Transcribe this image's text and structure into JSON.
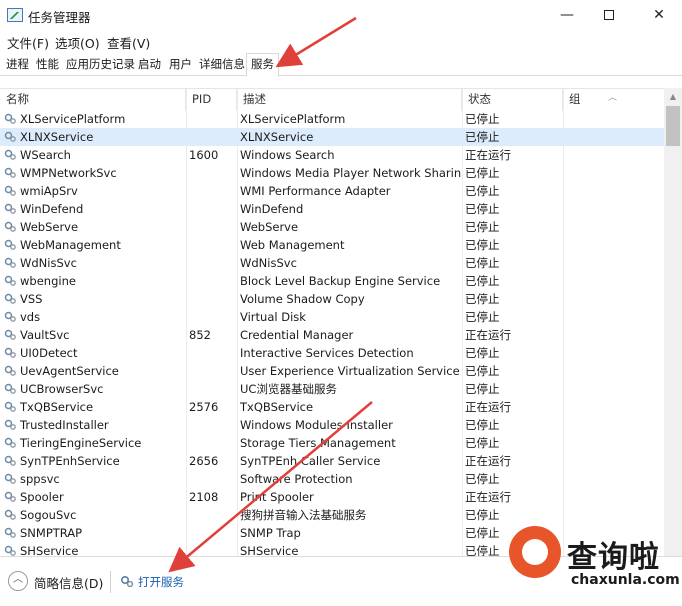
{
  "window": {
    "title": "任务管理器",
    "minimize_glyph": "—",
    "close_glyph": "✕"
  },
  "menu": [
    "文件(F)",
    "选项(O)",
    "查看(V)"
  ],
  "tabs": [
    "进程",
    "性能",
    "应用历史记录",
    "启动",
    "用户",
    "详细信息",
    "服务"
  ],
  "active_tab": "服务",
  "columns": {
    "name": "名称",
    "pid": "PID",
    "desc": "描述",
    "status": "状态",
    "group": "组"
  },
  "rows": [
    {
      "name": "XLServicePlatform",
      "pid": "",
      "desc": "XLServicePlatform",
      "status": "已停止",
      "group": ""
    },
    {
      "name": "XLNXService",
      "pid": "",
      "desc": "XLNXService",
      "status": "已停止",
      "group": "",
      "selected": true
    },
    {
      "name": "WSearch",
      "pid": "1600",
      "desc": "Windows Search",
      "status": "正在运行",
      "group": ""
    },
    {
      "name": "WMPNetworkSvc",
      "pid": "",
      "desc": "Windows Media Player Network Sharing ...",
      "status": "已停止",
      "group": ""
    },
    {
      "name": "wmiApSrv",
      "pid": "",
      "desc": "WMI Performance Adapter",
      "status": "已停止",
      "group": ""
    },
    {
      "name": "WinDefend",
      "pid": "",
      "desc": "WinDefend",
      "status": "已停止",
      "group": ""
    },
    {
      "name": "WebServe",
      "pid": "",
      "desc": "WebServe",
      "status": "已停止",
      "group": ""
    },
    {
      "name": "WebManagement",
      "pid": "",
      "desc": "Web Management",
      "status": "已停止",
      "group": ""
    },
    {
      "name": "WdNisSvc",
      "pid": "",
      "desc": "WdNisSvc",
      "status": "已停止",
      "group": ""
    },
    {
      "name": "wbengine",
      "pid": "",
      "desc": "Block Level Backup Engine Service",
      "status": "已停止",
      "group": ""
    },
    {
      "name": "VSS",
      "pid": "",
      "desc": "Volume Shadow Copy",
      "status": "已停止",
      "group": ""
    },
    {
      "name": "vds",
      "pid": "",
      "desc": "Virtual Disk",
      "status": "已停止",
      "group": ""
    },
    {
      "name": "VaultSvc",
      "pid": "852",
      "desc": "Credential Manager",
      "status": "正在运行",
      "group": ""
    },
    {
      "name": "UI0Detect",
      "pid": "",
      "desc": "Interactive Services Detection",
      "status": "已停止",
      "group": ""
    },
    {
      "name": "UevAgentService",
      "pid": "",
      "desc": "User Experience Virtualization Service",
      "status": "已停止",
      "group": ""
    },
    {
      "name": "UCBrowserSvc",
      "pid": "",
      "desc": "UC浏览器基础服务",
      "status": "已停止",
      "group": ""
    },
    {
      "name": "TxQBService",
      "pid": "2576",
      "desc": "TxQBService",
      "status": "正在运行",
      "group": ""
    },
    {
      "name": "TrustedInstaller",
      "pid": "",
      "desc": "Windows Modules Installer",
      "status": "已停止",
      "group": ""
    },
    {
      "name": "TieringEngineService",
      "pid": "",
      "desc": "Storage Tiers Management",
      "status": "已停止",
      "group": ""
    },
    {
      "name": "SynTPEnhService",
      "pid": "2656",
      "desc": "SynTPEnh Caller Service",
      "status": "正在运行",
      "group": ""
    },
    {
      "name": "sppsvc",
      "pid": "",
      "desc": "Software Protection",
      "status": "已停止",
      "group": ""
    },
    {
      "name": "Spooler",
      "pid": "2108",
      "desc": "Print Spooler",
      "status": "正在运行",
      "group": ""
    },
    {
      "name": "SogouSvc",
      "pid": "",
      "desc": "搜狗拼音输入法基础服务",
      "status": "已停止",
      "group": ""
    },
    {
      "name": "SNMPTRAP",
      "pid": "",
      "desc": "SNMP Trap",
      "status": "已停止",
      "group": ""
    },
    {
      "name": "SHService",
      "pid": "",
      "desc": "SHService",
      "status": "已停止",
      "group": ""
    }
  ],
  "footer": {
    "fewer_details": "简略信息",
    "fewer_hotkey": "(D)",
    "open_services": "打开服务"
  },
  "watermark": {
    "text": "查询啦",
    "domain": "chaxunla.com"
  },
  "colors": {
    "selected_row": "#dcecfc",
    "link": "#1a5eb0",
    "annotation_arrow": "#e0403a",
    "watermark_accent": "#e9552b"
  }
}
